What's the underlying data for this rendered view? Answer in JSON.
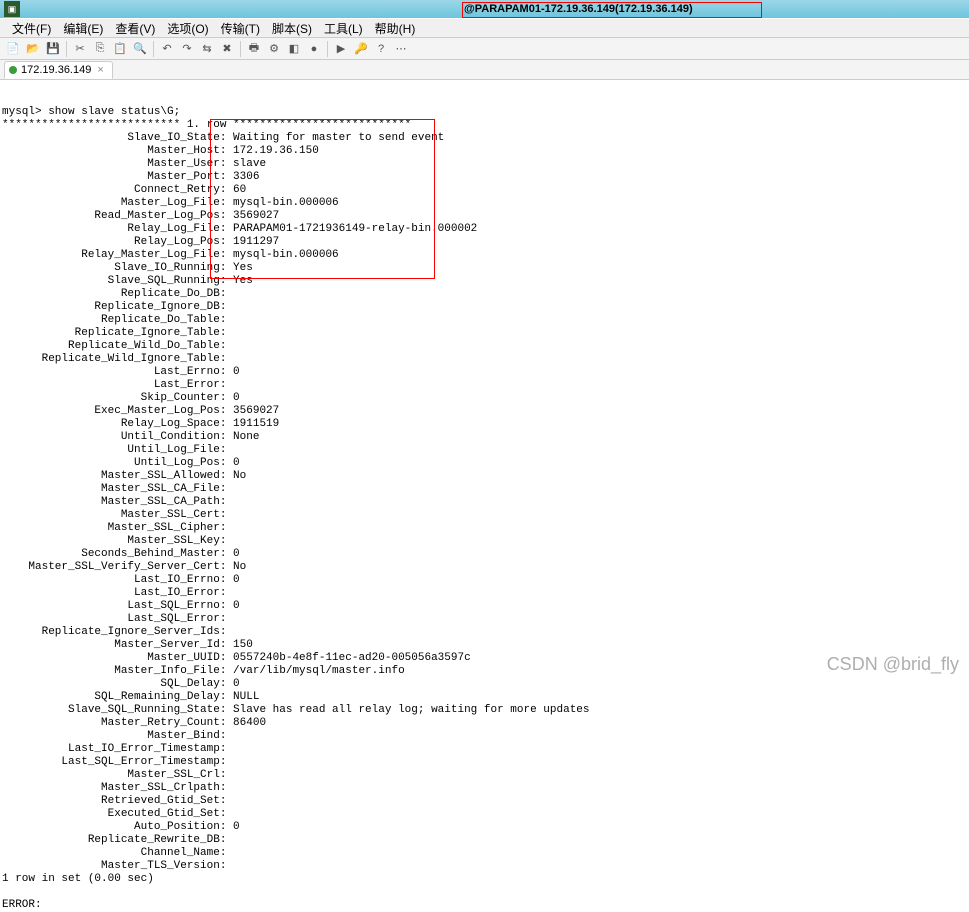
{
  "title": "@PARAPAM01-172.19.36.149(172.19.36.149)",
  "menu": [
    "文件(F)",
    "编辑(E)",
    "查看(V)",
    "选项(O)",
    "传输(T)",
    "脚本(S)",
    "工具(L)",
    "帮助(H)"
  ],
  "toolbar_icons": [
    "folder-new-icon",
    "folder-open-icon",
    "save-icon",
    "cut-icon",
    "copy-icon",
    "paste-icon",
    "find-icon",
    "undo-icon",
    "redo-icon",
    "connect-icon",
    "disconnect-icon",
    "print-icon",
    "printer-setup-icon",
    "toggle-icon",
    "record-icon",
    "play-icon",
    "key-icon",
    "help-icon",
    "options-icon"
  ],
  "tab": {
    "label": "172.19.36.149"
  },
  "prompt": "mysql> ",
  "command": "show slave status\\G;",
  "row_header": "*************************** 1. row ***************************",
  "status": {
    "Slave_IO_State": "Waiting for master to send event",
    "Master_Host": "172.19.36.150",
    "Master_User": "slave",
    "Master_Port": "3306",
    "Connect_Retry": "60",
    "Master_Log_File": "mysql-bin.000006",
    "Read_Master_Log_Pos": "3569027",
    "Relay_Log_File": "PARAPAM01-1721936149-relay-bin.000002",
    "Relay_Log_Pos": "1911297",
    "Relay_Master_Log_File": "mysql-bin.000006",
    "Slave_IO_Running": "Yes",
    "Slave_SQL_Running": "Yes",
    "Replicate_Do_DB": "",
    "Replicate_Ignore_DB": "",
    "Replicate_Do_Table": "",
    "Replicate_Ignore_Table": "",
    "Replicate_Wild_Do_Table": "",
    "Replicate_Wild_Ignore_Table": "",
    "Last_Errno": "0",
    "Last_Error": "",
    "Skip_Counter": "0",
    "Exec_Master_Log_Pos": "3569027",
    "Relay_Log_Space": "1911519",
    "Until_Condition": "None",
    "Until_Log_File": "",
    "Until_Log_Pos": "0",
    "Master_SSL_Allowed": "No",
    "Master_SSL_CA_File": "",
    "Master_SSL_CA_Path": "",
    "Master_SSL_Cert": "",
    "Master_SSL_Cipher": "",
    "Master_SSL_Key": "",
    "Seconds_Behind_Master": "0",
    "Master_SSL_Verify_Server_Cert": "No",
    "Last_IO_Errno": "0",
    "Last_IO_Error": "",
    "Last_SQL_Errno": "0",
    "Last_SQL_Error": "",
    "Replicate_Ignore_Server_Ids": "",
    "Master_Server_Id": "150",
    "Master_UUID": "0557240b-4e8f-11ec-ad20-005056a3597c",
    "Master_Info_File": "/var/lib/mysql/master.info",
    "SQL_Delay": "0",
    "SQL_Remaining_Delay": "NULL",
    "Slave_SQL_Running_State": "Slave has read all relay log; waiting for more updates",
    "Master_Retry_Count": "86400",
    "Master_Bind": "",
    "Last_IO_Error_Timestamp": "",
    "Last_SQL_Error_Timestamp": "",
    "Master_SSL_Crl": "",
    "Master_SSL_Crlpath": "",
    "Retrieved_Gtid_Set": "",
    "Executed_Gtid_Set": "",
    "Auto_Position": "0",
    "Replicate_Rewrite_DB": "",
    "Channel_Name": "",
    "Master_TLS_Version": ""
  },
  "footer1": "1 row in set (0.00 sec)",
  "footer_blank": "",
  "footer2": "ERROR:",
  "watermark": "CSDN @brid_fly"
}
